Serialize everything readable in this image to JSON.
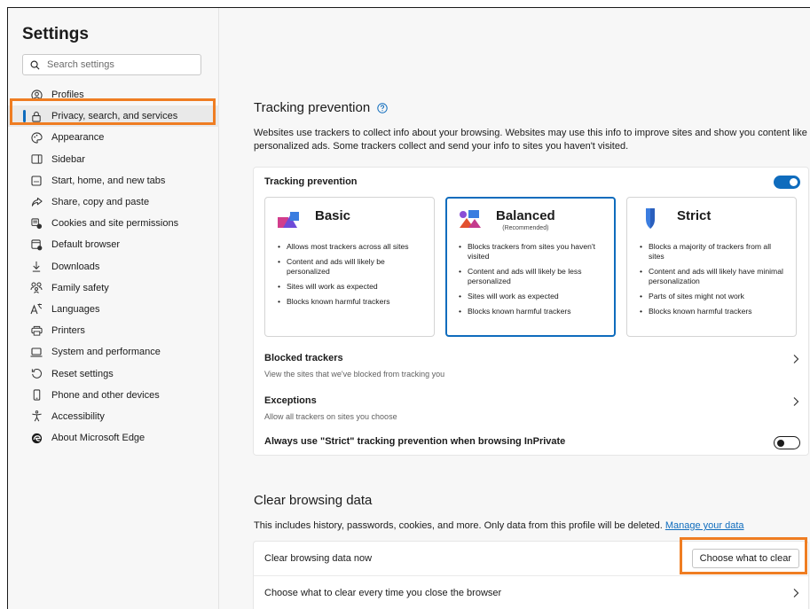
{
  "sidebar": {
    "title": "Settings",
    "search_placeholder": "Search settings",
    "items": [
      {
        "label": "Profiles",
        "icon": "profile-icon"
      },
      {
        "label": "Privacy, search, and services",
        "icon": "lock-icon",
        "active": true
      },
      {
        "label": "Appearance",
        "icon": "palette-icon"
      },
      {
        "label": "Sidebar",
        "icon": "sidebar-icon"
      },
      {
        "label": "Start, home, and new tabs",
        "icon": "home-tabs-icon"
      },
      {
        "label": "Share, copy and paste",
        "icon": "share-icon"
      },
      {
        "label": "Cookies and site permissions",
        "icon": "permissions-icon"
      },
      {
        "label": "Default browser",
        "icon": "browser-icon"
      },
      {
        "label": "Downloads",
        "icon": "download-icon"
      },
      {
        "label": "Family safety",
        "icon": "family-icon"
      },
      {
        "label": "Languages",
        "icon": "language-icon"
      },
      {
        "label": "Printers",
        "icon": "printer-icon"
      },
      {
        "label": "System and performance",
        "icon": "laptop-icon"
      },
      {
        "label": "Reset settings",
        "icon": "reset-icon"
      },
      {
        "label": "Phone and other devices",
        "icon": "phone-icon"
      },
      {
        "label": "Accessibility",
        "icon": "accessibility-icon"
      },
      {
        "label": "About Microsoft Edge",
        "icon": "edge-logo-icon"
      }
    ]
  },
  "tracking": {
    "title": "Tracking prevention",
    "description": "Websites use trackers to collect info about your browsing. Websites may use this info to improve sites and show you content like personalized ads. Some trackers collect and send your info to sites you haven't visited.",
    "card_title": "Tracking prevention",
    "enabled": true,
    "options": [
      {
        "name": "Basic",
        "recommended": "",
        "bullets": [
          "Allows most trackers across all sites",
          "Content and ads will likely be personalized",
          "Sites will work as expected",
          "Blocks known harmful trackers"
        ]
      },
      {
        "name": "Balanced",
        "recommended": "(Recommended)",
        "selected": true,
        "bullets": [
          "Blocks trackers from sites you haven't visited",
          "Content and ads will likely be less personalized",
          "Sites will work as expected",
          "Blocks known harmful trackers"
        ]
      },
      {
        "name": "Strict",
        "recommended": "",
        "bullets": [
          "Blocks a majority of trackers from all sites",
          "Content and ads will likely have minimal personalization",
          "Parts of sites might not work",
          "Blocks known harmful trackers"
        ]
      }
    ],
    "blocked_title": "Blocked trackers",
    "blocked_sub": "View the sites that we've blocked from tracking you",
    "exceptions_title": "Exceptions",
    "exceptions_sub": "Allow all trackers on sites you choose",
    "strict_inprivate": "Always use \"Strict\" tracking prevention when browsing InPrivate",
    "strict_inprivate_enabled": false
  },
  "clear": {
    "title": "Clear browsing data",
    "description": "This includes history, passwords, cookies, and more. Only data from this profile will be deleted.",
    "manage_link": "Manage your data",
    "now_label": "Clear browsing data now",
    "button_label": "Choose what to clear",
    "every_time_label": "Choose what to clear every time you close the browser"
  },
  "colors": {
    "accent": "#0f6cbd",
    "highlight": "#ef7d22"
  }
}
